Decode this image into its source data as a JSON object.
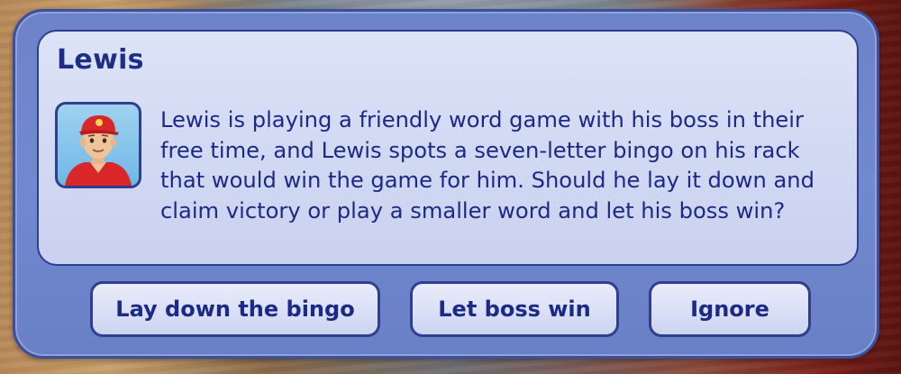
{
  "dialog": {
    "title": "Lewis",
    "portrait_icon": "sim-portrait-icon",
    "message": "Lewis is playing a friendly word game with his boss in their free time, and Lewis spots a seven-letter bingo on his rack that would win the game for him. Should he lay it down and claim victory or play a smaller word and let his boss win?",
    "buttons": [
      {
        "label": "Lay down the bingo"
      },
      {
        "label": "Let boss win"
      },
      {
        "label": "Ignore"
      }
    ]
  },
  "colors": {
    "frame": "#6d83c9",
    "panel": "#d3daf3",
    "text": "#1c2a86",
    "border": "#2e3f8f"
  }
}
